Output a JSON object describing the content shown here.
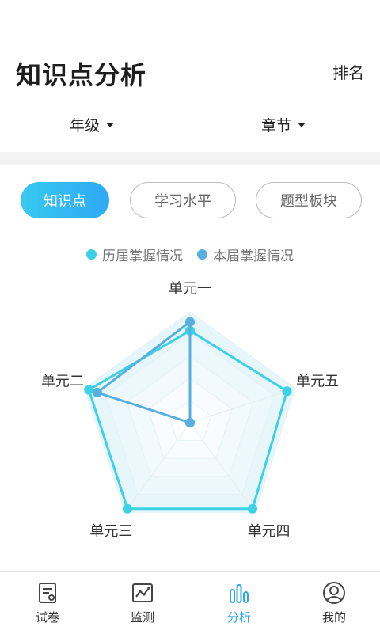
{
  "header": {
    "title": "知识点分析",
    "rank_label": "排名"
  },
  "filters": [
    {
      "label": "年级",
      "icon": "caret-down-icon"
    },
    {
      "label": "章节",
      "icon": "caret-down-icon"
    }
  ],
  "tabs": [
    {
      "label": "知识点",
      "active": true
    },
    {
      "label": "学习水平",
      "active": false
    },
    {
      "label": "题型板块",
      "active": false
    }
  ],
  "legend": [
    {
      "label": "历届掌握情况",
      "color": "#3dd1e6"
    },
    {
      "label": "本届掌握情况",
      "color": "#56afde"
    }
  ],
  "chart_data": {
    "type": "radar",
    "axes": [
      "单元一",
      "单元五",
      "单元四",
      "单元三",
      "单元二"
    ],
    "series": [
      {
        "name": "历届掌握情况",
        "color": "#3dd1e6",
        "values": [
          0.83,
          0.92,
          0.96,
          0.96,
          0.96
        ]
      },
      {
        "name": "本届掌握情况",
        "color": "#56afde",
        "values": [
          0.91,
          0.0,
          0.0,
          0.0,
          0.88
        ]
      }
    ],
    "range": [
      0,
      1
    ]
  },
  "tabbar": [
    {
      "label": "试卷",
      "icon": "paper-icon",
      "active": false
    },
    {
      "label": "监测",
      "icon": "monitor-chart-icon",
      "active": false
    },
    {
      "label": "分析",
      "icon": "bar-chart-icon",
      "active": true
    },
    {
      "label": "我的",
      "icon": "profile-icon",
      "active": false
    }
  ]
}
